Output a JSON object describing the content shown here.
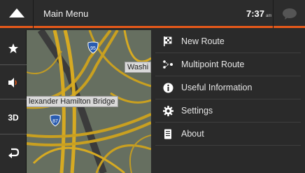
{
  "header": {
    "title": "Main Menu",
    "time": "7:37",
    "ampm": "am",
    "accent": "#e8591a"
  },
  "sidebar": {
    "items": [
      {
        "icon": "star-icon",
        "label": ""
      },
      {
        "icon": "speaker-icon",
        "label": ""
      },
      {
        "icon": "",
        "label": "3D"
      },
      {
        "icon": "return-icon",
        "label": ""
      }
    ]
  },
  "map": {
    "labels": {
      "street_partial": "Washi",
      "bridge": "lexander Hamilton Bridge"
    },
    "shields": [
      "95",
      "87"
    ]
  },
  "menu": {
    "items": [
      {
        "icon": "checkered-flag-icon",
        "label": "New Route"
      },
      {
        "icon": "multipoint-route-icon",
        "label": "Multipoint Route"
      },
      {
        "icon": "info-icon",
        "label": "Useful Information"
      },
      {
        "icon": "gear-icon",
        "label": "Settings"
      },
      {
        "icon": "book-icon",
        "label": "About"
      }
    ]
  }
}
